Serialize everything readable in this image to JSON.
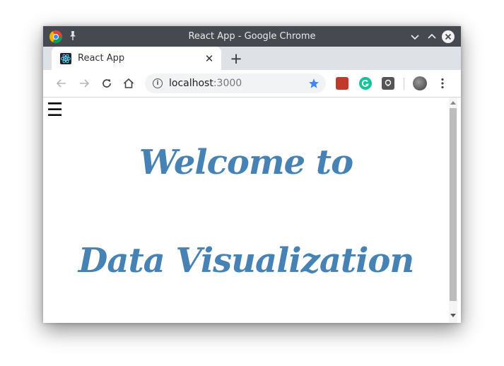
{
  "window": {
    "title": "React App - Google Chrome"
  },
  "tab": {
    "title": "React App",
    "close_glyph": "✕"
  },
  "newtab": {
    "glyph": "+"
  },
  "toolbar": {
    "url_host": "localhost",
    "url_port": ":3000"
  },
  "page": {
    "menu_glyph": "☰",
    "heading_line1": "Welcome to",
    "heading_line2": "Data Visualization"
  },
  "colors": {
    "titlebar": "#464a50",
    "heading": "#4682b4",
    "bookmark_star": "#4285f4"
  }
}
